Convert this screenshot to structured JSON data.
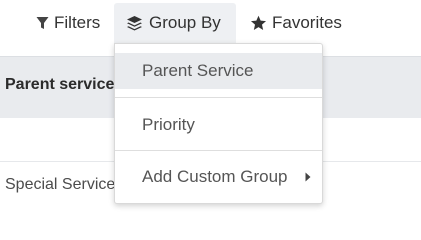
{
  "toolbar": {
    "filters_label": "Filters",
    "filters_icon": "filter-icon",
    "groupby_label": "Group By",
    "groupby_icon": "layers-icon",
    "favorites_label": "Favorites",
    "favorites_icon": "star-icon"
  },
  "table": {
    "header": "Parent service",
    "rows": [
      "",
      "Special Service"
    ]
  },
  "groupby_menu": {
    "items": [
      {
        "label": "Parent Service",
        "highlighted": true
      },
      {
        "label": "Priority"
      }
    ],
    "custom_group_label": "Add Custom Group",
    "custom_group_icon": "caret-right-icon"
  },
  "colors": {
    "active_bg": "#eef0f3",
    "highlight_bg": "#e9ebee",
    "text": "#4c4c4c"
  }
}
